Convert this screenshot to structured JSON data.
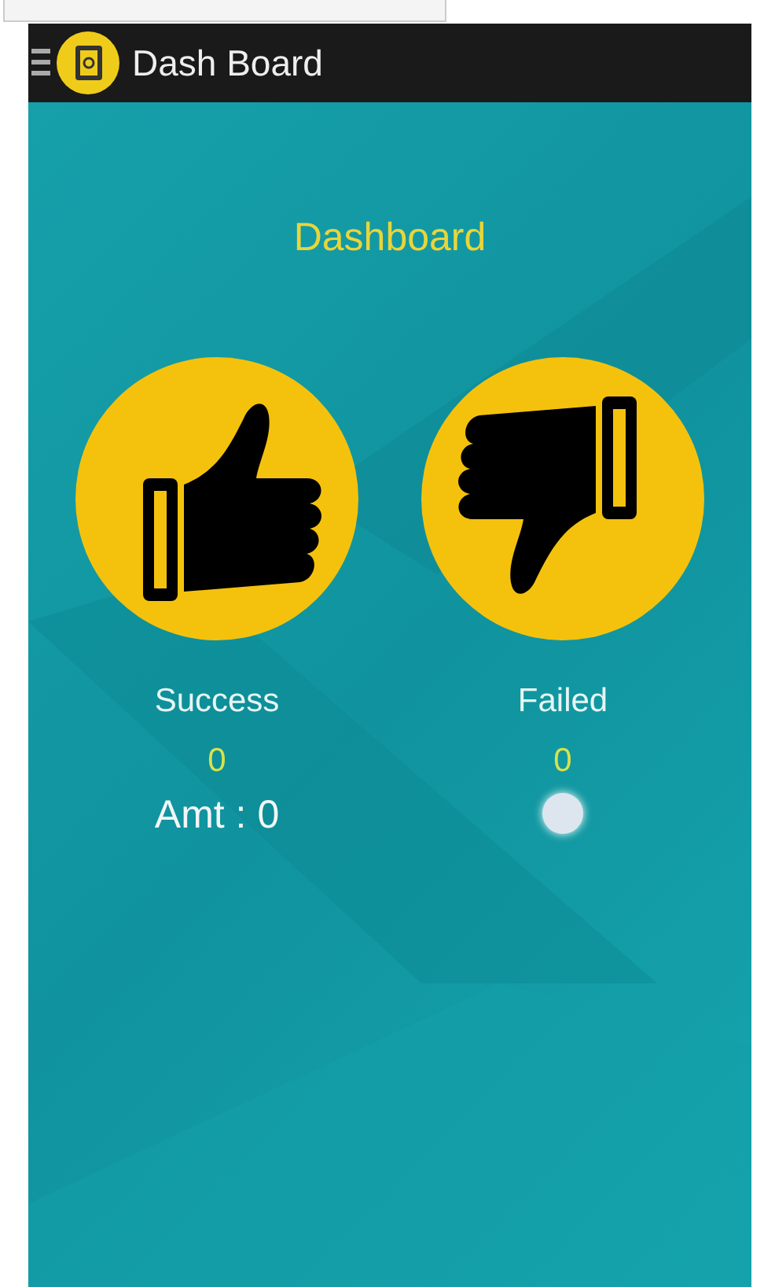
{
  "app_bar": {
    "title": "Dash Board"
  },
  "heading": "Dashboard",
  "cards": [
    {
      "kind": "up",
      "label": "Success",
      "count": "0",
      "amount": "Amt : 0"
    },
    {
      "kind": "down",
      "label": "Failed",
      "count": "0"
    }
  ]
}
